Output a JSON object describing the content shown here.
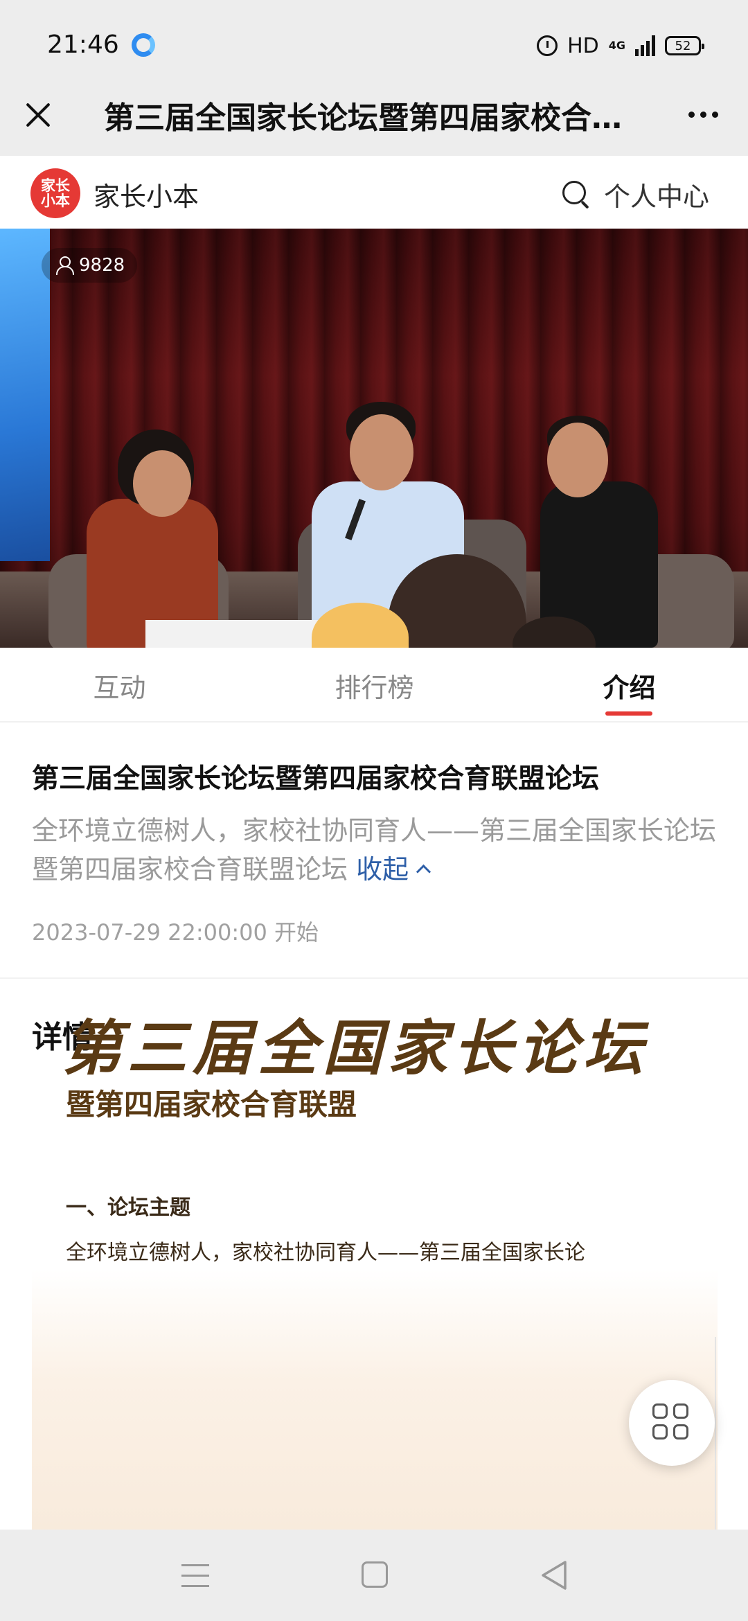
{
  "status_bar": {
    "time": "21:46",
    "hd_label": "HD",
    "network_label": "4G",
    "battery": "52",
    "icons": [
      "app-notification-icon",
      "alarm-icon",
      "signal-icon",
      "battery-icon"
    ]
  },
  "title_bar": {
    "title": "第三届全国家长论坛暨第四届家校合…"
  },
  "app_header": {
    "logo_line1": "家长",
    "logo_line2": "小本",
    "brand": "家长小本",
    "personal_center": "个人中心"
  },
  "video": {
    "viewer_count": "9828"
  },
  "tabs": [
    {
      "label": "互动",
      "active": false
    },
    {
      "label": "排行榜",
      "active": false
    },
    {
      "label": "介绍",
      "active": true
    }
  ],
  "intro": {
    "title": "第三届全国家长论坛暨第四届家校合育联盟论坛",
    "description": "全环境立德树人，家校社协同育人——第三届全国家长论坛暨第四届家校合育联盟论坛",
    "collapse_label": "收起",
    "start_time": "2023-07-29 22:00:00 开始"
  },
  "details": {
    "heading": "详情",
    "poster_title": "第三届全国家长论坛",
    "poster_subtitle": "暨第四届家校合育联盟",
    "poster_section": "一、论坛主题",
    "poster_body": "全环境立德树人，家校社协同育人——第三届全国家长论"
  },
  "colors": {
    "accent_red": "#e53935",
    "link_blue": "#2e5fa8",
    "poster_brown": "#5a3a14"
  }
}
